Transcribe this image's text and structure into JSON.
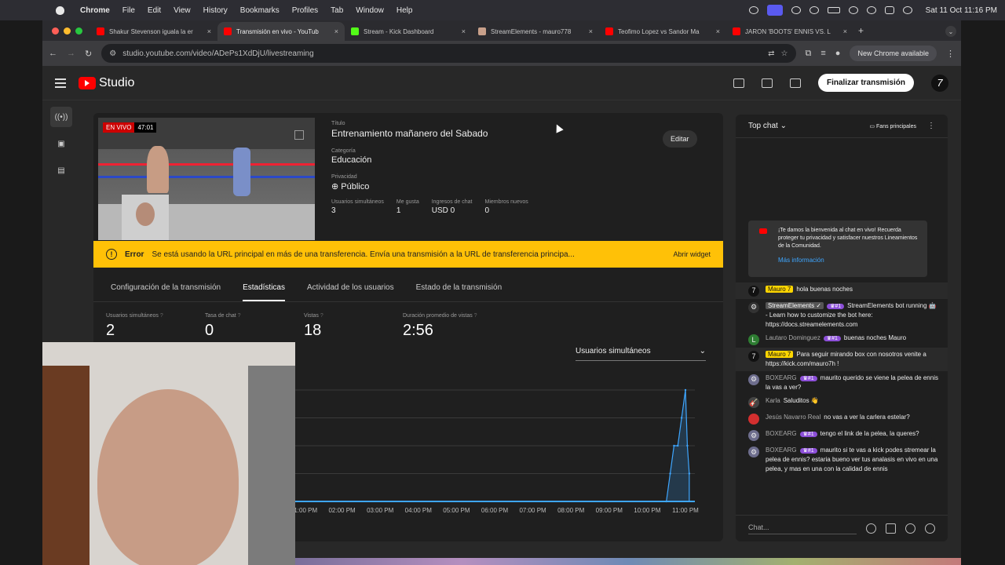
{
  "menubar": {
    "items": [
      "Chrome",
      "File",
      "Edit",
      "View",
      "History",
      "Bookmarks",
      "Profiles",
      "Tab",
      "Window",
      "Help"
    ],
    "clock": "Sat 11 Oct  11:16 PM"
  },
  "tabs": [
    {
      "title": "Shakur Stevenson iguala la er",
      "color": "#ff0000",
      "active": false
    },
    {
      "title": "Transmisión en vivo - YouTub",
      "color": "#ff0000",
      "active": true
    },
    {
      "title": "Stream - Kick Dashboard",
      "color": "#53fc18",
      "active": false
    },
    {
      "title": "StreamElements - mauro778",
      "color": "#c8a08a",
      "active": false
    },
    {
      "title": "Teofimo Lopez vs Sandor Ma",
      "color": "#ff0000",
      "active": false
    },
    {
      "title": "JARON 'BOOTS' ENNIS VS. L",
      "color": "#ff0000",
      "active": false
    }
  ],
  "toolbar": {
    "url": "studio.youtube.com/video/ADePs1XdDjU/livestreaming",
    "new_chrome": "New Chrome available"
  },
  "studio": {
    "brand": "Studio",
    "finish_button": "Finalizar transmisión",
    "avatar": "7"
  },
  "stream": {
    "live_label": "EN VIVO",
    "elapsed": "47:01",
    "title_label": "Título",
    "title": "Entrenamiento mañanero del Sabado",
    "category_label": "Categoría",
    "category": "Educación",
    "privacy_label": "Privacidad",
    "privacy": "Público",
    "edit_button": "Editar",
    "stats": [
      {
        "label": "Usuarios simultáneos",
        "value": "3"
      },
      {
        "label": "Me gusta",
        "value": "1"
      },
      {
        "label": "Ingresos de chat",
        "value": "USD 0"
      },
      {
        "label": "Miembros nuevos",
        "value": "0"
      }
    ]
  },
  "error": {
    "word": "Error",
    "message": "Se está usando la URL principal en más de una transferencia. Envía una transmisión a la URL de transferencia principa...",
    "action": "Abrir widget"
  },
  "section_tabs": [
    {
      "label": "Configuración de la transmisión",
      "active": false
    },
    {
      "label": "Estadísticas",
      "active": true
    },
    {
      "label": "Actividad de los usuarios",
      "active": false
    },
    {
      "label": "Estado de la transmisión",
      "active": false
    }
  ],
  "metrics": [
    {
      "label": "Usuarios simultáneos",
      "value": "2"
    },
    {
      "label": "Tasa de chat",
      "value": "0"
    },
    {
      "label": "Vistas",
      "value": "18"
    },
    {
      "label": "Duración promedio de vistas",
      "value": "2:56"
    }
  ],
  "metric_selector": "Usuarios simultáneos",
  "chart_data": {
    "type": "area",
    "categories": [
      "01:00 PM",
      "02:00 PM",
      "03:00 PM",
      "04:00 PM",
      "05:00 PM",
      "06:00 PM",
      "07:00 PM",
      "08:00 PM",
      "09:00 PM",
      "10:00 PM",
      "11:00 PM"
    ],
    "x": [
      10.5,
      10.6,
      10.7,
      10.8,
      10.9,
      11.0,
      11.05,
      11.1
    ],
    "values": [
      0,
      1,
      2,
      2,
      3,
      4,
      2,
      1
    ],
    "ylim": [
      0,
      4
    ],
    "grid": true,
    "color": "#3ea6ff"
  },
  "chat": {
    "mode": "Top chat",
    "fans": "Fans principales",
    "welcome": "¡Te damos la bienvenida al chat en vivo! Recuerda proteger tu privacidad y satisfacer nuestros Lineamientos de la Comunidad.",
    "more": "Más información",
    "input_placeholder": "Chat...",
    "messages": [
      {
        "author": "Mauro 7",
        "role": "owner",
        "badge": "",
        "text": "hola buenas noches",
        "avatar_color": "#111",
        "avatar_text": "7"
      },
      {
        "author": "StreamElements ✓",
        "role": "mod",
        "badge": "#1",
        "text": "StreamElements bot running 🤖 - Learn how to customize the bot here: https://docs.streamelements.com",
        "avatar_color": "#333",
        "avatar_text": "⚙"
      },
      {
        "author": "Lautaro Dominguez",
        "role": "",
        "badge": "#1",
        "text": "buenas noches Mauro",
        "avatar_color": "#2e7d32",
        "avatar_text": "L"
      },
      {
        "author": "Mauro 7",
        "role": "owner",
        "badge": "",
        "text": "Para seguir mirando box con nosotros venite a https://kick.com/mauro7h !",
        "avatar_color": "#111",
        "avatar_text": "7"
      },
      {
        "author": "BOXEARG",
        "role": "",
        "badge": "#1",
        "text": "maurito querido se viene la pelea de ennis la vas a ver?",
        "avatar_color": "#6d6d8d",
        "avatar_text": "⚙"
      },
      {
        "author": "Karla",
        "role": "",
        "badge": "",
        "text": "Saluditos 👋",
        "avatar_color": "#444",
        "avatar_text": "🎸"
      },
      {
        "author": "Jesús Navarro Real",
        "role": "",
        "badge": "",
        "text": "no vas a ver la carlera estelar?",
        "avatar_color": "#d32f2f",
        "avatar_text": ""
      },
      {
        "author": "BOXEARG",
        "role": "",
        "badge": "#1",
        "text": "tengo el link de la pelea, la queres?",
        "avatar_color": "#6d6d8d",
        "avatar_text": "⚙"
      },
      {
        "author": "BOXEARG",
        "role": "",
        "badge": "#1",
        "text": "maurito si te vas a kick podes stremear la pelea de ennis? estaria bueno ver tus analasis en vivo en una pelea, y mas en una con la calidad de ennis",
        "avatar_color": "#6d6d8d",
        "avatar_text": "⚙"
      }
    ]
  }
}
